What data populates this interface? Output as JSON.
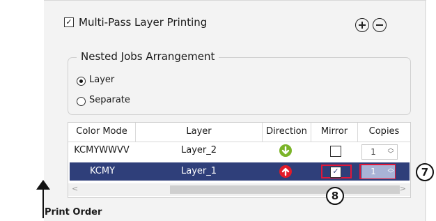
{
  "multipass": {
    "label": "Multi-Pass Layer Printing",
    "checked": true,
    "check_glyph": "✓"
  },
  "buttons": {
    "add_icon": "plus-circle-icon",
    "remove_icon": "minus-circle-icon"
  },
  "nested": {
    "title": "Nested Jobs Arrangement",
    "options": [
      {
        "label": "Layer",
        "selected": true
      },
      {
        "label": "Separate",
        "selected": false
      }
    ]
  },
  "table": {
    "headers": [
      "Color Mode",
      "Layer",
      "Direction",
      "Mirror",
      "Copies"
    ],
    "rows": [
      {
        "color_mode": "KCMYWWVV",
        "layer": "Layer_2",
        "direction": "down",
        "direction_color": "#7bb428",
        "mirror": false,
        "copies": "1"
      },
      {
        "color_mode": "KCMY",
        "layer": "Layer_1",
        "direction": "up",
        "direction_color": "#e21b2a",
        "mirror": true,
        "copies": "1",
        "selected": true
      }
    ],
    "scroll_left": "<",
    "scroll_right": ">"
  },
  "callouts": {
    "copies": "7",
    "mirror": "8"
  },
  "print_order": {
    "label": "Print Order"
  },
  "colors": {
    "selected_row": "#2f3f7a",
    "highlight_border": "#e0183a"
  }
}
